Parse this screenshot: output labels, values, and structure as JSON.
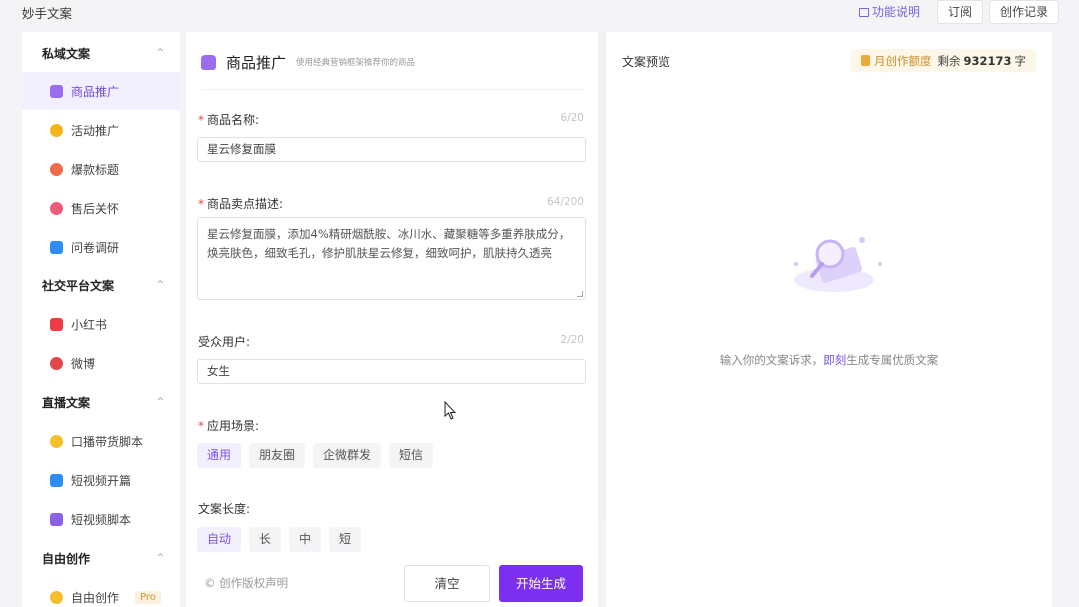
{
  "app_title": "妙手文案",
  "top_actions": {
    "guide": "功能说明",
    "subscribe": "订阅",
    "history": "创作记录"
  },
  "sidebar": {
    "groups": [
      {
        "title": "私域文案",
        "items": [
          {
            "label": "商品推广",
            "icon": "bag-icon",
            "color": "#9a6df0",
            "active": true
          },
          {
            "label": "活动推广",
            "icon": "gift-icon",
            "color": "#f3b51c"
          },
          {
            "label": "爆款标题",
            "icon": "fire-icon",
            "color": "#f06a4c"
          },
          {
            "label": "售后关怀",
            "icon": "heart-icon",
            "color": "#ef5a7a"
          },
          {
            "label": "问卷调研",
            "icon": "survey-icon",
            "color": "#2f8cf2"
          }
        ]
      },
      {
        "title": "社交平台文案",
        "items": [
          {
            "label": "小红书",
            "icon": "xiaohongshu-icon",
            "color": "#ef3b45"
          },
          {
            "label": "微博",
            "icon": "weibo-icon",
            "color": "#e2484a"
          }
        ]
      },
      {
        "title": "直播文案",
        "items": [
          {
            "label": "口播带货脚本",
            "icon": "smile-icon",
            "color": "#f5be2b"
          },
          {
            "label": "短视频开篇",
            "icon": "video-icon",
            "color": "#2f8cf2"
          },
          {
            "label": "短视频脚本",
            "icon": "clapper-icon",
            "color": "#8a62e6"
          }
        ]
      },
      {
        "title": "自由创作",
        "items": [
          {
            "label": "自由创作",
            "icon": "sparkle-icon",
            "color": "#f5be2b",
            "badge": "Pro"
          }
        ]
      }
    ]
  },
  "form": {
    "title": "商品推广",
    "subtitle": "使用经典营销框架推荐你的商品",
    "product_name": {
      "label": "商品名称:",
      "counter": "6/20",
      "value": "星云修复面膜"
    },
    "selling_points": {
      "label": "商品卖点描述:",
      "counter": "64/200",
      "value": "星云修复面膜，添加4%精研烟酰胺、冰川水、藏聚糖等多重养肤成分，焕亮肤色，细致毛孔，修护肌肤星云修复，细致呵护，肌肤持久透亮"
    },
    "audience": {
      "label": "受众用户:",
      "counter": "2/20",
      "value": "女生"
    },
    "scene": {
      "label": "应用场景:",
      "options": [
        "通用",
        "朋友圈",
        "企微群发",
        "短信"
      ],
      "selected": "通用"
    },
    "length": {
      "label": "文案长度:",
      "options": [
        "自动",
        "长",
        "中",
        "短"
      ],
      "selected": "自动"
    },
    "copyright": "© 创作版权声明",
    "clear_label": "清空",
    "generate_label": "开始生成"
  },
  "preview": {
    "title": "文案预览",
    "quota_label": "月创作额度",
    "quota_rest": "剩余",
    "quota_value": "932173",
    "quota_unit": "字",
    "empty_before": "输入你的文案诉求，",
    "empty_link": "即刻",
    "empty_after": "生成专属优质文案"
  },
  "colors": {
    "accent": "#7b2ff0",
    "active_bg": "#f2efff",
    "quota_bg": "#fdf7ea"
  }
}
